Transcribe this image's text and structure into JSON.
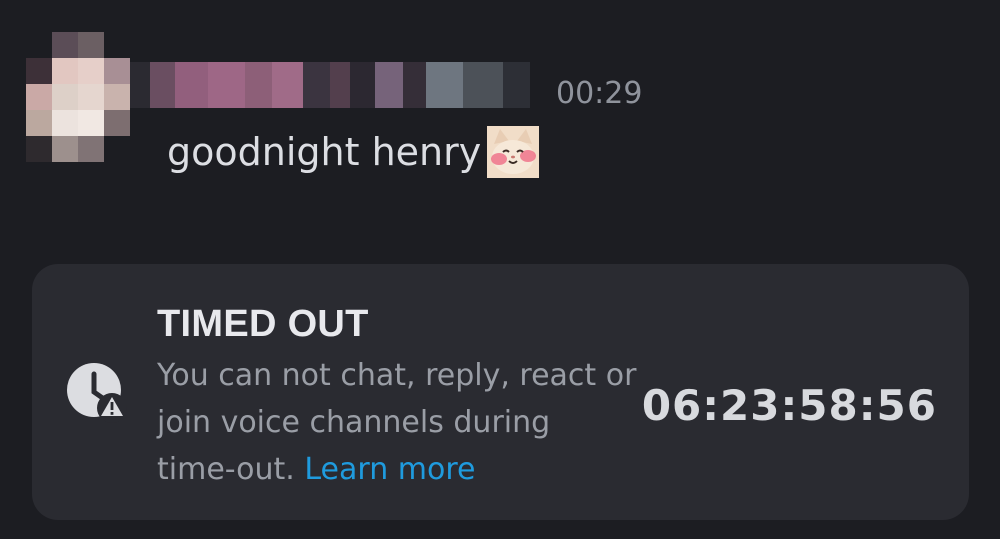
{
  "message": {
    "timestamp": "00:29",
    "text": "goodnight henry",
    "emoji": "blushing-cat-emoji"
  },
  "timeout": {
    "title": "TIMED OUT",
    "description": "You can not chat, reply, react or join voice channels during time-out.",
    "link_label": "Learn more",
    "countdown": "06:23:58:56",
    "icon": "clock-warning-icon"
  },
  "colors": {
    "background": "#1c1d22",
    "card": "#2a2b31",
    "link": "#1f9bde",
    "title": "#e8e9ed",
    "muted": "#9a9ea6"
  }
}
